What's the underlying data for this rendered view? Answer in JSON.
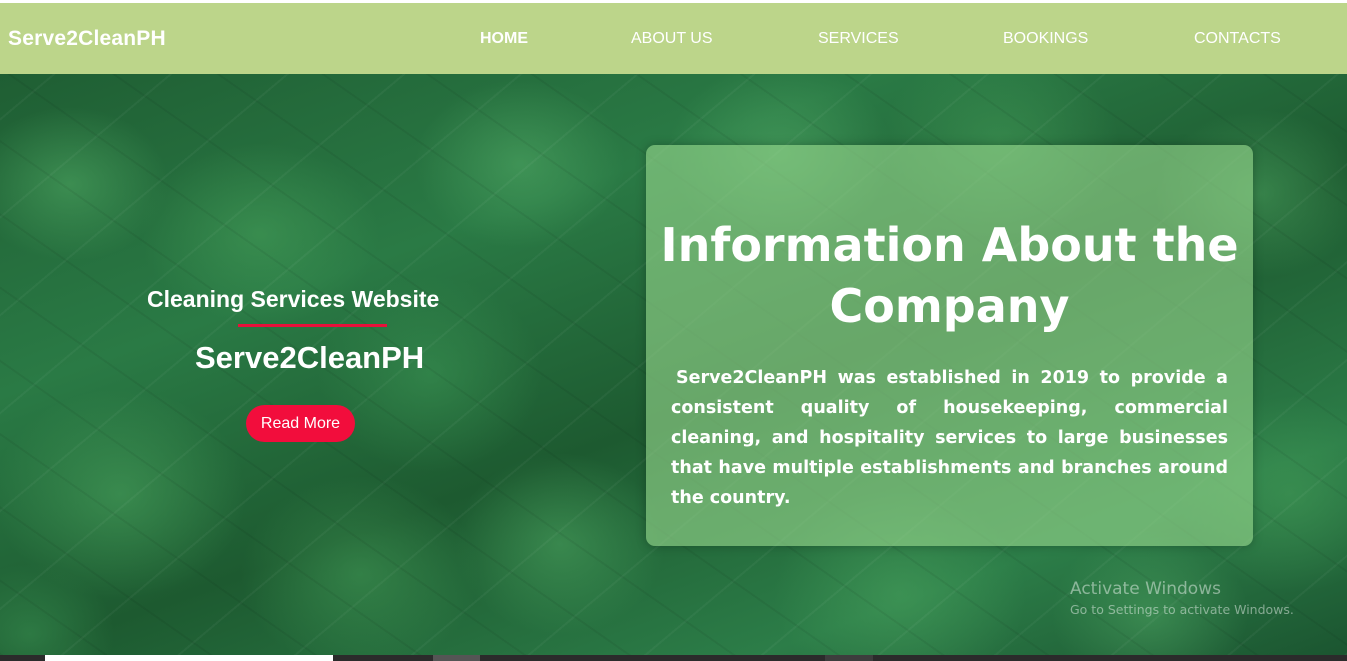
{
  "navbar": {
    "brand": "Serve2CleanPH",
    "links": [
      {
        "label": "HOME",
        "active": true
      },
      {
        "label": "ABOUT US",
        "active": false
      },
      {
        "label": "SERVICES",
        "active": false
      },
      {
        "label": "BOOKINGS",
        "active": false
      },
      {
        "label": "CONTACTS",
        "active": false
      }
    ],
    "background_color": "#bcd58a"
  },
  "hero": {
    "subtitle": "Cleaning Services Website",
    "title": "Serve2CleanPH",
    "read_more_label": "Read More",
    "accent_color": "#f20d3c"
  },
  "info_card": {
    "heading": "Information About the Company",
    "text": "Serve2CleanPH was established in 2019 to provide a consistent quality of housekeeping, commercial cleaning, and hospitality services to large businesses that have multiple establishments and branches around the country."
  },
  "watermark": {
    "title": "Activate Windows",
    "subtitle": "Go to Settings to activate Windows."
  }
}
